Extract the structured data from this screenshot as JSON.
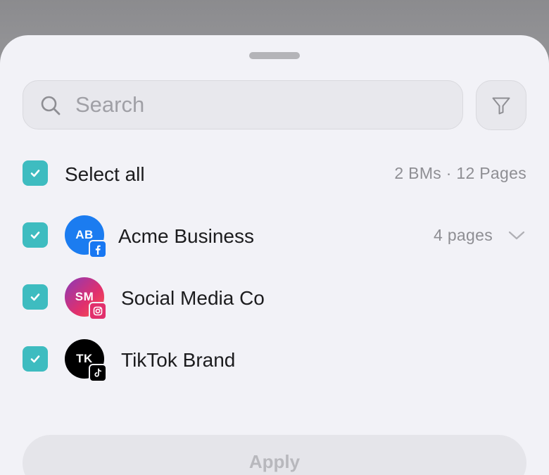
{
  "search": {
    "placeholder": "Search",
    "value": ""
  },
  "select_all": {
    "label": "Select all",
    "summary": "2 BMs · 12 Pages",
    "checked": true
  },
  "accounts": [
    {
      "initials": "AB",
      "name": "Acme Business",
      "platform": "facebook-icon",
      "pages": "4 pages",
      "color": "#1877f2",
      "checked": true
    },
    {
      "initials": "SM",
      "name": "Social Media Co",
      "platform": "instagram-icon",
      "color": "#c13584",
      "checked": true
    },
    {
      "initials": "TK",
      "name": "TikTok Brand",
      "platform": "tiktok-icon",
      "color": "#000000",
      "checked": true
    }
  ],
  "apply": {
    "label": "Apply"
  },
  "colors": {
    "accent": "#3ebcc0",
    "sheet": "#f2f2f7",
    "facebook": "#1877f2",
    "instagram": "#e1306c",
    "tiktok": "#000000"
  }
}
